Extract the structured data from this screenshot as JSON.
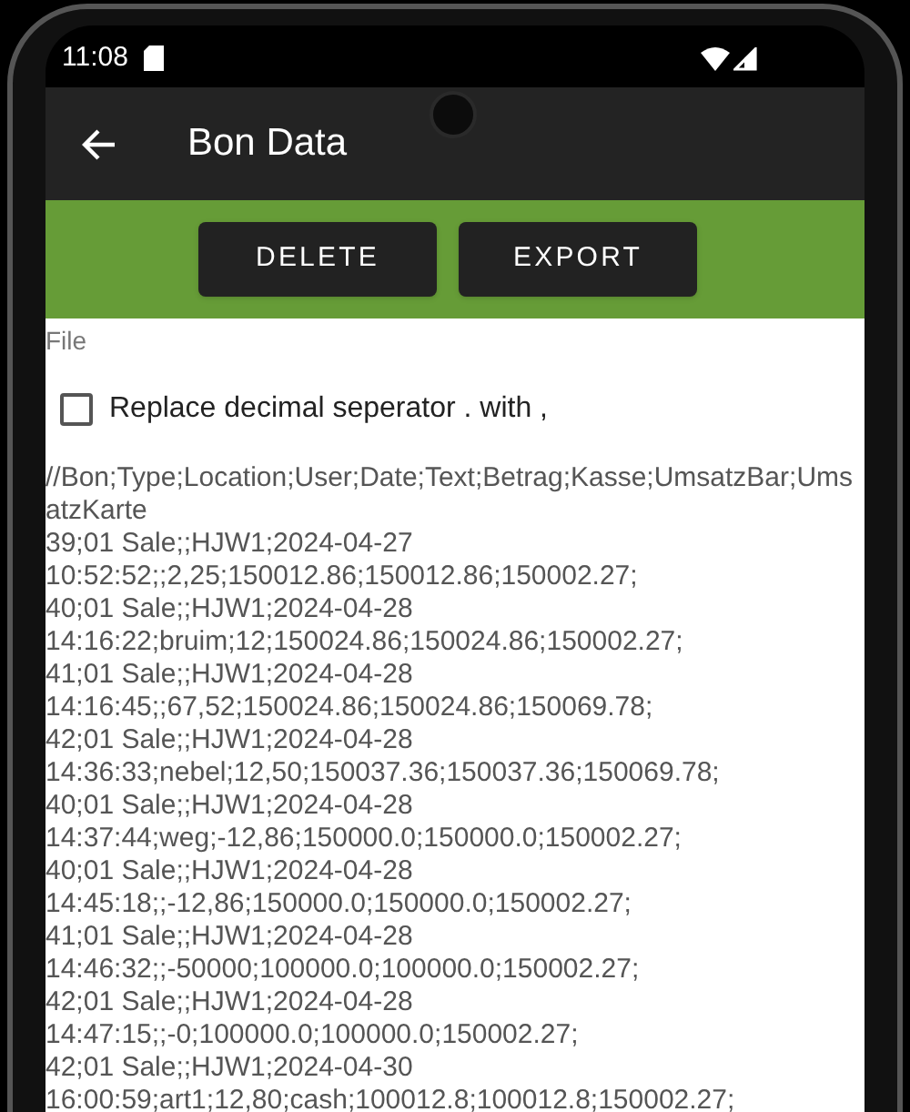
{
  "status_bar": {
    "time": "11:08"
  },
  "app_bar": {
    "title": "Bon Data"
  },
  "actions": [
    "DELETE",
    "EXPORT"
  ],
  "file_label": "File",
  "replace_option": {
    "label": "Replace decimal seperator . with ,",
    "checked": false
  },
  "file_lines": [
    "//Bon;Type;Location;User;Date;Text;Betrag;Kasse;UmsatzBar;Ums",
    "atzKarte",
    "39;01 Sale;;HJW1;2024-04-27",
    "10:52:52;;2,25;150012.86;150012.86;150002.27;",
    "40;01 Sale;;HJW1;2024-04-28",
    "14:16:22;bruim;12;150024.86;150024.86;150002.27;",
    "41;01 Sale;;HJW1;2024-04-28",
    "14:16:45;;67,52;150024.86;150024.86;150069.78;",
    "42;01 Sale;;HJW1;2024-04-28",
    "14:36:33;nebel;12,50;150037.36;150037.36;150069.78;",
    "40;01 Sale;;HJW1;2024-04-28",
    "14:37:44;weg;-12,86;150000.0;150000.0;150002.27;",
    "40;01 Sale;;HJW1;2024-04-28",
    "14:45:18;;-12,86;150000.0;150000.0;150002.27;",
    "41;01 Sale;;HJW1;2024-04-28",
    "14:46:32;;-50000;100000.0;100000.0;150002.27;",
    "42;01 Sale;;HJW1;2024-04-28",
    "14:47:15;;-0;100000.0;100000.0;150002.27;",
    "42;01 Sale;;HJW1;2024-04-30",
    "16:00:59;art1;12,80;cash;100012.8;100012.8;150002.27;"
  ]
}
